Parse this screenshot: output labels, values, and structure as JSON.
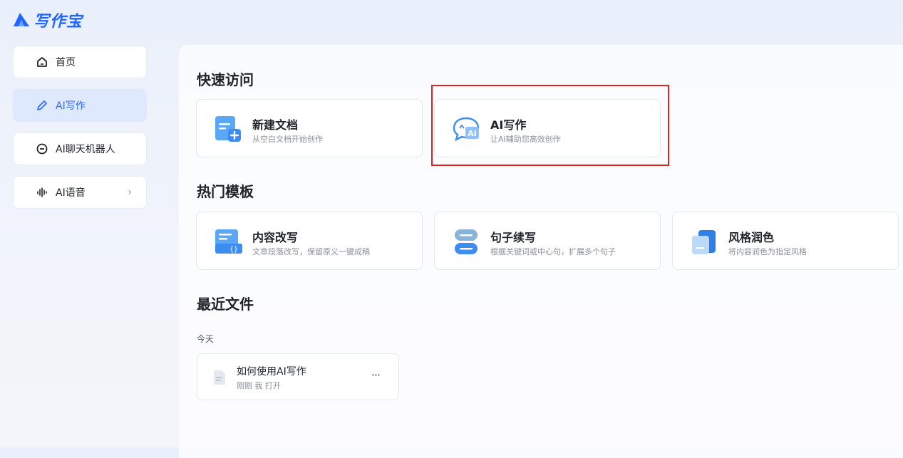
{
  "app": {
    "name": "写作宝",
    "brand_color": "#2266ff",
    "accent_color": "#2f6bff"
  },
  "sidebar": {
    "items": [
      {
        "label": "首页",
        "icon": "home-icon"
      },
      {
        "label": "AI写作",
        "icon": "pen-icon",
        "active": true
      },
      {
        "label": "AI聊天机器人",
        "icon": "chat-bubble-icon"
      },
      {
        "label": "AI语音",
        "icon": "soundwave-icon",
        "chevron": "›"
      }
    ]
  },
  "quick_access": {
    "title": "快速访问",
    "cards": [
      {
        "title": "新建文档",
        "desc": "从空白文档开始创作",
        "icon": "new-document-icon"
      },
      {
        "title": "AI写作",
        "desc": "让AI辅助您高效创作",
        "icon": "ai-chat-icon",
        "highlighted": true
      }
    ]
  },
  "templates": {
    "title": "热门模板",
    "cards": [
      {
        "title": "内容改写",
        "desc": "文章段落改写，保留原义一键成稿",
        "icon": "rewrite-icon"
      },
      {
        "title": "句子续写",
        "desc": "根据关键词或中心句，扩展多个句子",
        "icon": "continue-writing-icon"
      },
      {
        "title": "风格润色",
        "desc": "将内容润色为指定风格",
        "icon": "style-polish-icon"
      }
    ]
  },
  "recent": {
    "title": "最近文件",
    "group_label": "今天",
    "files": [
      {
        "name": "如何使用AI写作",
        "meta": "刚刚 我 打开",
        "more": "···"
      }
    ]
  },
  "highlight_color": "#e02424"
}
